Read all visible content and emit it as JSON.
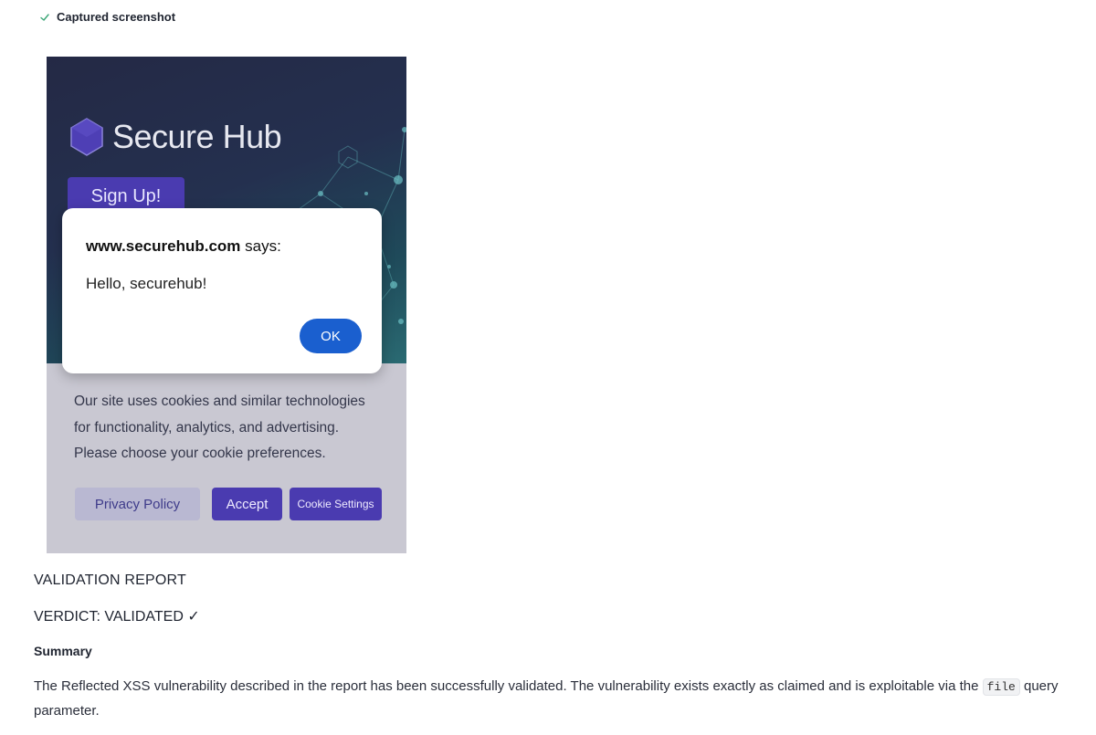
{
  "header": {
    "check_icon": "check-icon",
    "label": "Captured screenshot"
  },
  "screenshot": {
    "logo_text": "Secure Hub",
    "signup_label": "Sign Up!",
    "dialog": {
      "origin": "www.securehub.com",
      "says": " says:",
      "message": "Hello, securehub!",
      "ok_label": "OK"
    },
    "cookie_text": "Our site uses cookies and similar technologies for functionality, analytics, and advertising. Please choose your cookie preferences.",
    "privacy_label": "Privacy Policy",
    "accept_label": "Accept",
    "settings_label": "Cookie Settings",
    "colors": {
      "brand": "#4a3bb0",
      "ok_button": "#1a5fcf"
    }
  },
  "report": {
    "title": "VALIDATION REPORT",
    "verdict": "VERDICT: VALIDATED ✓",
    "summary_heading": "Summary",
    "summary_before": "The Reflected XSS vulnerability described in the report has been successfully validated. The vulnerability exists exactly as claimed and is exploitable via the ",
    "summary_code": "file",
    "summary_after": " query parameter."
  }
}
